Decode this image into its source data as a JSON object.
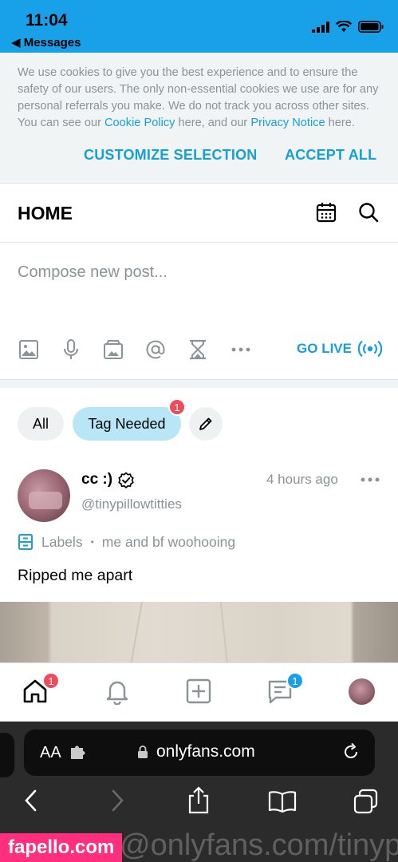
{
  "status": {
    "time": "11:04",
    "back_label": "◀ Messages"
  },
  "cookie": {
    "text_1": "We use cookies to give you the best experience and to ensure the safety of our users. The only non-essential cookies we use are for any personal referrals you make. We do not track you across other sites. You can see our ",
    "link_1": "Cookie Policy",
    "text_2": " here, and our ",
    "link_2": "Privacy Notice",
    "text_3": " here.",
    "customize_label": "CUSTOMIZE SELECTION",
    "accept_label": "ACCEPT ALL"
  },
  "header": {
    "title": "HOME"
  },
  "compose": {
    "placeholder": "Compose new post...",
    "go_live_label": "GO LIVE"
  },
  "filters": {
    "all_label": "All",
    "tag_label": "Tag Needed",
    "tag_badge": "1"
  },
  "post": {
    "name": "cc :)",
    "handle": "@tinypillowtitties",
    "time": "4 hours ago",
    "labels_label": "Labels",
    "label_value": "me and bf woohooing",
    "text": "Ripped me apart"
  },
  "nav": {
    "home_badge": "1",
    "messages_badge": "1"
  },
  "browser": {
    "aa_label": "AA",
    "url": "onlyfans.com"
  },
  "watermark": {
    "label": "fapello.com",
    "trail": "@onlyfans.com/tinypillowti"
  },
  "colors": {
    "accent": "#15a0d6",
    "status_bar": "#18a0e8",
    "badge": "#ef4b5b",
    "muted": "#8a9396"
  }
}
